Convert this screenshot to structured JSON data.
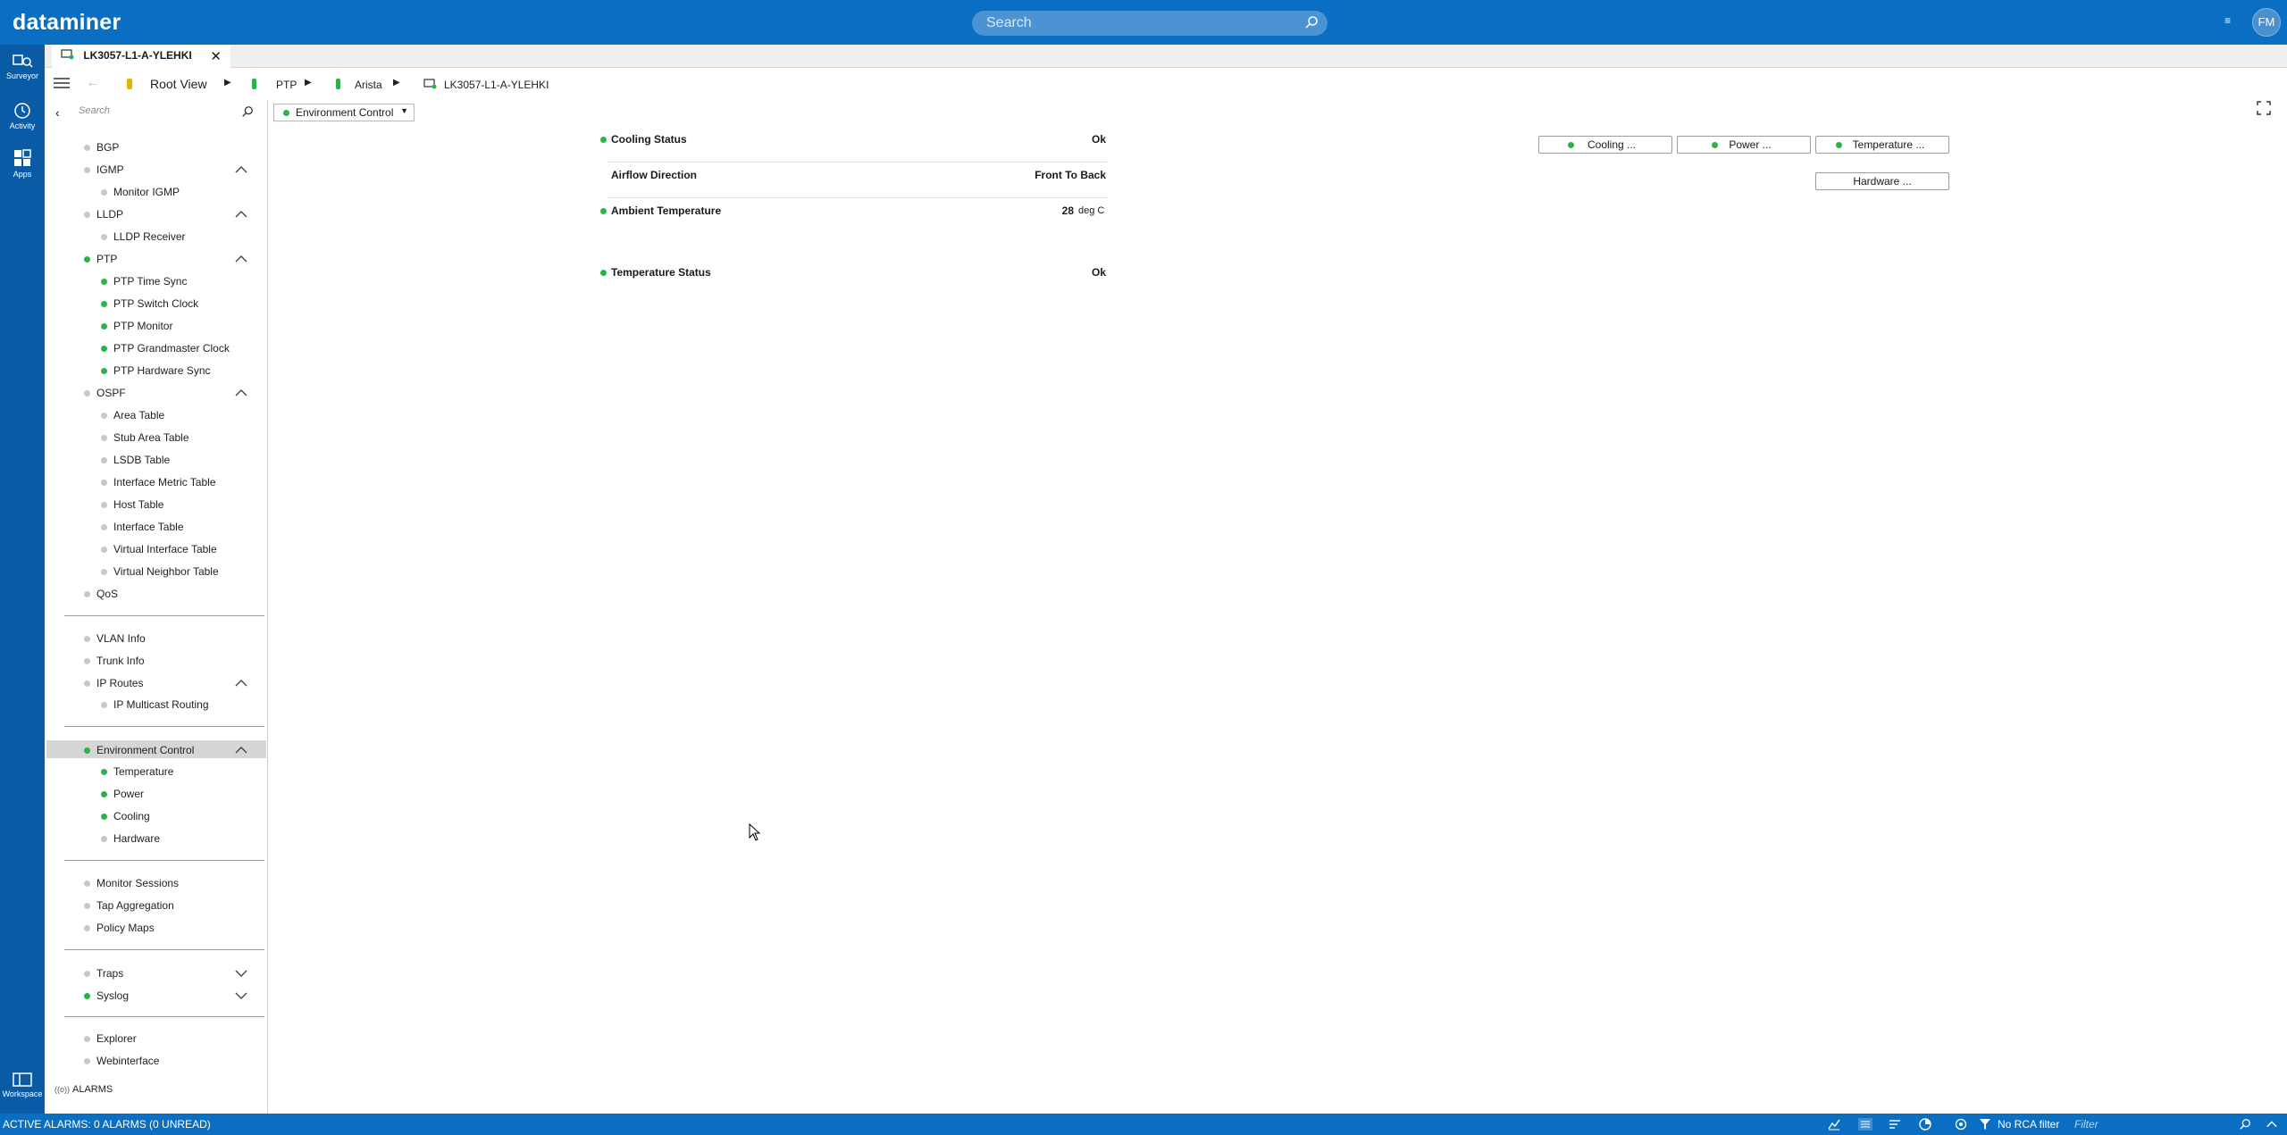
{
  "app": {
    "title": "dataminer",
    "user_initials": "FM"
  },
  "search": {
    "placeholder": "Search"
  },
  "rail": {
    "surveyor": "Surveyor",
    "activity": "Activity",
    "apps": "Apps",
    "workspace": "Workspace"
  },
  "tab": {
    "label": "LK3057-L1-A-YLEHKI"
  },
  "breadcrumb": {
    "root": "Root View",
    "ptp": "PTP",
    "arista": "Arista",
    "element": "LK3057-L1-A-YLEHKI"
  },
  "left_search": {
    "placeholder": "Search"
  },
  "nav": {
    "bgp": "BGP",
    "igmp": "IGMP",
    "monitor_igmp": "Monitor IGMP",
    "lldp": "LLDP",
    "lldp_receiver": "LLDP Receiver",
    "ptp": "PTP",
    "ptp_time_sync": "PTP Time Sync",
    "ptp_switch_clock": "PTP Switch Clock",
    "ptp_monitor": "PTP Monitor",
    "ptp_grandmaster": "PTP Grandmaster Clock",
    "ptp_hw_sync": "PTP Hardware Sync",
    "ospf": "OSPF",
    "area_table": "Area Table",
    "stub_area_table": "Stub Area Table",
    "lsdb_table": "LSDB Table",
    "interface_metric_table": "Interface Metric Table",
    "host_table": "Host Table",
    "interface_table": "Interface Table",
    "virtual_interface_table": "Virtual Interface Table",
    "virtual_neighbor_table": "Virtual Neighbor Table",
    "qos": "QoS",
    "vlan_info": "VLAN Info",
    "trunk_info": "Trunk Info",
    "ip_routes": "IP Routes",
    "ip_multicast_routing": "IP Multicast Routing",
    "environment_control": "Environment Control",
    "temperature": "Temperature",
    "power": "Power",
    "cooling": "Cooling",
    "hardware": "Hardware",
    "monitor_sessions": "Monitor Sessions",
    "tap_aggregation": "Tap Aggregation",
    "policy_maps": "Policy Maps",
    "traps": "Traps",
    "syslog": "Syslog",
    "explorer": "Explorer",
    "webinterface": "Webinterface",
    "alarms": "ALARMS"
  },
  "main": {
    "page_select": "Environment Control",
    "params": {
      "cooling_status": {
        "label": "Cooling Status",
        "value": "Ok"
      },
      "airflow_direction": {
        "label": "Airflow Direction",
        "value": "Front To Back"
      },
      "ambient_temperature": {
        "label": "Ambient Temperature",
        "value": "28",
        "unit": "deg C"
      },
      "temperature_status": {
        "label": "Temperature Status",
        "value": "Ok"
      }
    },
    "buttons": {
      "cooling": "Cooling ...",
      "power": "Power ...",
      "temperature": "Temperature ...",
      "hardware": "Hardware ..."
    }
  },
  "status": {
    "alarms": "ACTIVE ALARMS: 0 ALARMS (0 UNREAD)",
    "rca": "No RCA filter",
    "filter_placeholder": "Filter"
  },
  "colors": {
    "brand": "#0a6fc2",
    "rail": "#0a5ba6",
    "ok": "#2bb24a",
    "neutral": "#c8c8c8"
  }
}
